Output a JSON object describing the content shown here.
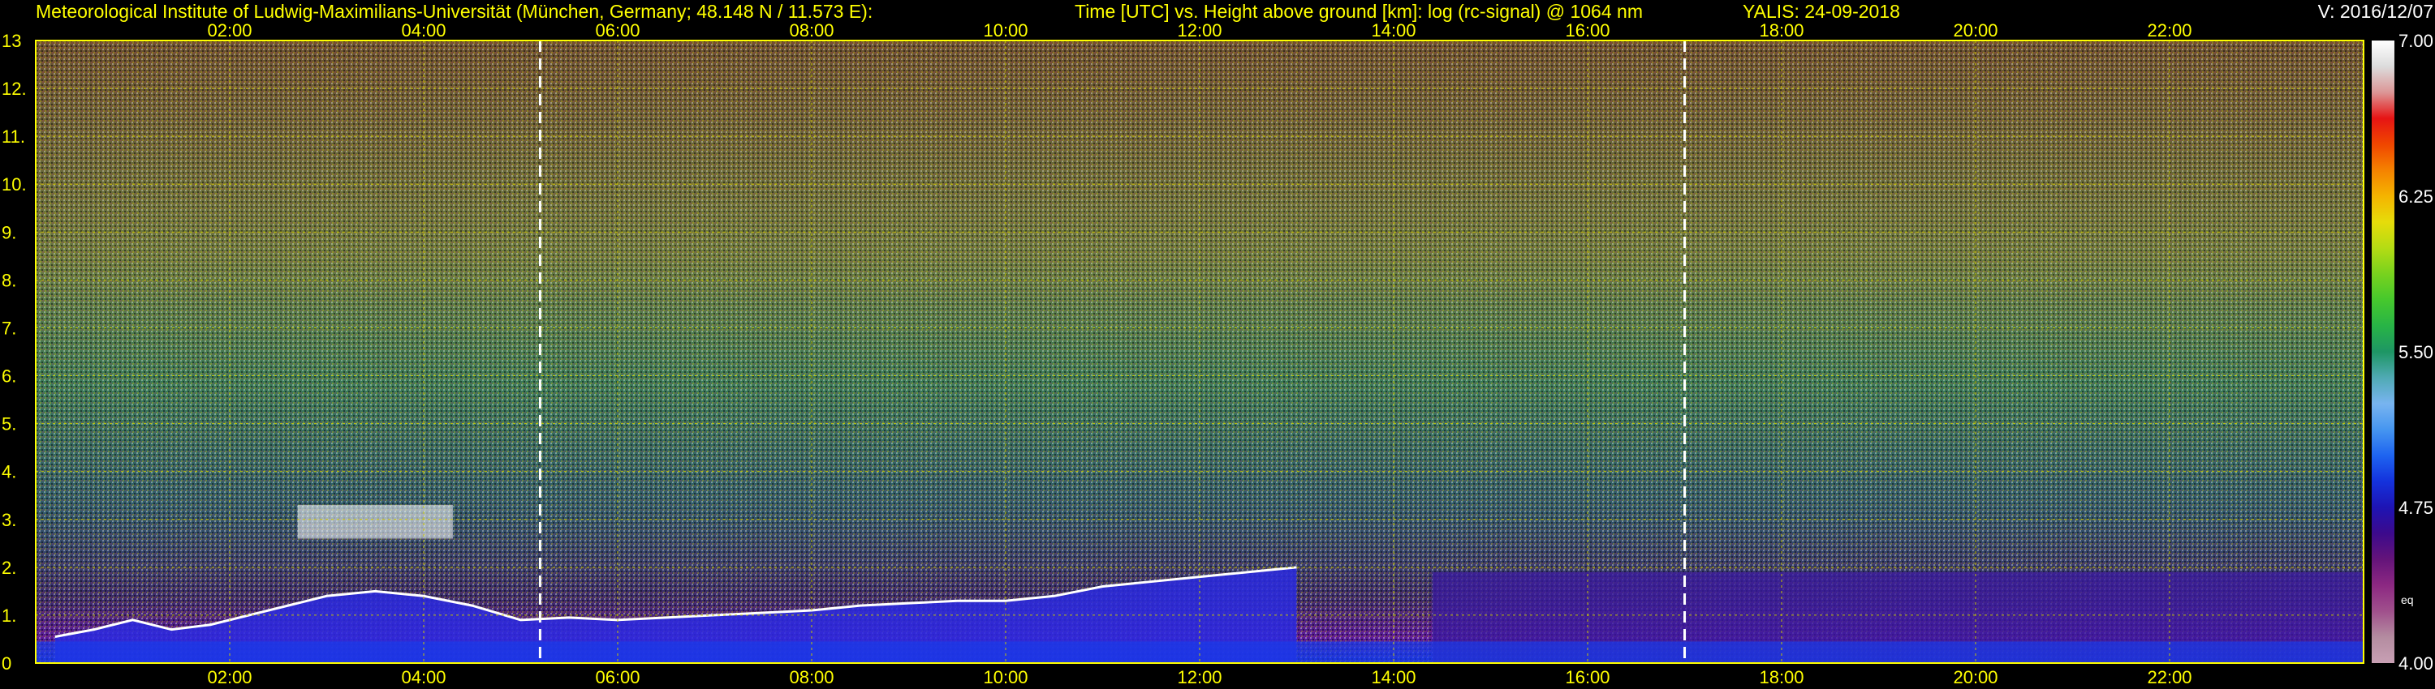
{
  "header": {
    "institute": "Meteorological Institute of Ludwig-Maximilians-Universität (München, Germany; 48.148 N / 11.573 E):",
    "axes_desc": "Time [UTC] vs. Height above ground [km]: log (rc-signal) @ 1064 nm",
    "instrument_date": "YALIS: 24-09-2018",
    "version": "V: 2016/12/07"
  },
  "chart_data": {
    "type": "heatmap",
    "x": {
      "label": "Time [UTC]",
      "range_hours": [
        0,
        24
      ],
      "ticks": [
        "02:00",
        "04:00",
        "06:00",
        "08:00",
        "10:00",
        "12:00",
        "14:00",
        "16:00",
        "18:00",
        "20:00",
        "22:00"
      ],
      "tick_hours": [
        2,
        4,
        6,
        8,
        10,
        12,
        14,
        16,
        18,
        20,
        22
      ]
    },
    "y": {
      "label": "Height above ground [km]",
      "range_km": [
        0,
        13
      ],
      "ticks": [
        "0",
        "1.",
        "2.",
        "3.",
        "4.",
        "5.",
        "6.",
        "7.",
        "8.",
        "9.",
        "10.",
        "11.",
        "12.",
        "13"
      ],
      "tick_values": [
        0,
        1,
        2,
        3,
        4,
        5,
        6,
        7,
        8,
        9,
        10,
        11,
        12,
        13
      ]
    },
    "colorbar": {
      "range": [
        4.0,
        7.0
      ],
      "tick_labels": [
        "4.00",
        "4.75",
        "5.50",
        "6.25",
        "7.00"
      ],
      "tick_values": [
        4.0,
        4.75,
        5.5,
        6.25,
        7.0
      ],
      "note": "eq",
      "colors": [
        "#c8a0b4",
        "#b48ca0",
        "#a0508c",
        "#8c2882",
        "#64147a",
        "#3c0a8c",
        "#1e14b4",
        "#1432dc",
        "#1e64f0",
        "#4696f0",
        "#78b4f0",
        "#50aab4",
        "#1e9664",
        "#28b446",
        "#46c82d",
        "#78d21e",
        "#b4dc14",
        "#e6dc0a",
        "#f5b400",
        "#f58200",
        "#f04600",
        "#e61414",
        "#dc9696",
        "#dcdcdc",
        "#ffffff"
      ]
    },
    "markers_hours": [
      5.2,
      17.0
    ],
    "boundary_layer_km": [
      [
        0.2,
        0.55
      ],
      [
        0.6,
        0.7
      ],
      [
        1.0,
        0.9
      ],
      [
        1.4,
        0.7
      ],
      [
        1.8,
        0.8
      ],
      [
        2.2,
        1.0
      ],
      [
        2.6,
        1.2
      ],
      [
        3.0,
        1.4
      ],
      [
        3.5,
        1.5
      ],
      [
        4.0,
        1.4
      ],
      [
        4.5,
        1.2
      ],
      [
        5.0,
        0.9
      ],
      [
        5.5,
        0.95
      ],
      [
        6.0,
        0.9
      ],
      [
        6.5,
        0.95
      ],
      [
        7.0,
        1.0
      ],
      [
        7.5,
        1.05
      ],
      [
        8.0,
        1.1
      ],
      [
        8.5,
        1.2
      ],
      [
        9.0,
        1.25
      ],
      [
        9.5,
        1.3
      ],
      [
        10.0,
        1.3
      ],
      [
        10.5,
        1.4
      ],
      [
        11.0,
        1.6
      ],
      [
        11.5,
        1.7
      ],
      [
        12.0,
        1.8
      ],
      [
        12.5,
        1.9
      ],
      [
        13.0,
        2.0
      ]
    ],
    "cloud_patches": [
      {
        "t": [
          2.7,
          4.3
        ],
        "z": [
          2.6,
          3.3
        ]
      }
    ]
  }
}
